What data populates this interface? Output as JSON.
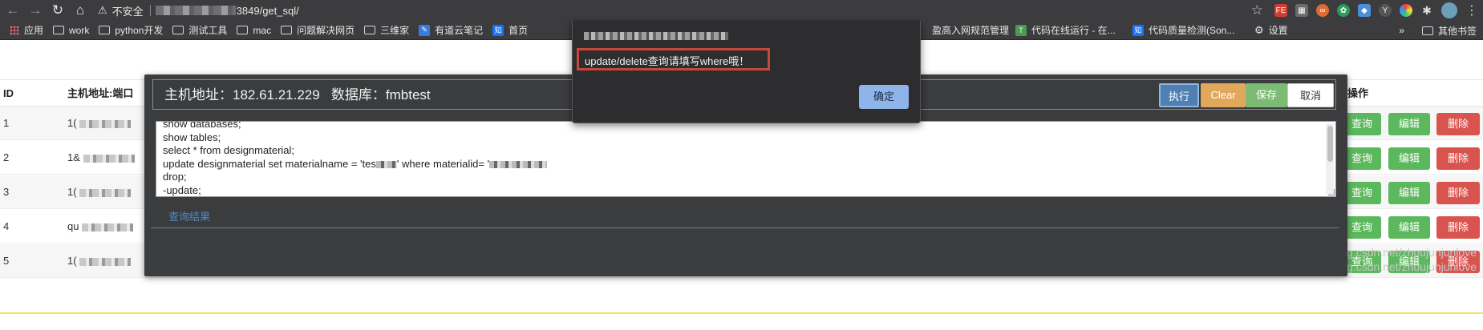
{
  "browser": {
    "insecure_label": "不安全",
    "url_suffix": "3849/get_sql/",
    "bookmarks": [
      {
        "label": "应用",
        "icon": "apps-icon"
      },
      {
        "label": "work",
        "icon": "folder-icon"
      },
      {
        "label": "python开发",
        "icon": "folder-icon"
      },
      {
        "label": "测试工具",
        "icon": "folder-icon"
      },
      {
        "label": "mac",
        "icon": "folder-icon"
      },
      {
        "label": "问题解决网页",
        "icon": "folder-icon"
      },
      {
        "label": "三维家",
        "icon": "folder-icon"
      },
      {
        "label": "有道云笔记",
        "icon": "youdao-icon"
      },
      {
        "label": "首页",
        "icon": "zhihu-icon"
      }
    ],
    "bookmarks_right": [
      {
        "label": "盈高入网规范管理"
      },
      {
        "label": "代码在线运行 - 在..."
      },
      {
        "label": "代码质量检测(Son..."
      },
      {
        "label": "设置"
      }
    ],
    "other_bookmarks": "其他书签"
  },
  "table": {
    "headers": {
      "id": "ID",
      "host": "主机地址:端口",
      "actions": "操作"
    },
    "rows": [
      {
        "id": "1",
        "host_prefix": "1("
      },
      {
        "id": "2",
        "host_prefix": "1&"
      },
      {
        "id": "3",
        "host_prefix": "1("
      },
      {
        "id": "4",
        "host_prefix": "qu"
      },
      {
        "id": "5",
        "host_prefix": "1("
      }
    ],
    "query_label": "查询",
    "edit_label": "编辑",
    "delete_label": "删除"
  },
  "panel": {
    "host_label": "主机地址：182.61.21.229",
    "db_label": "数据库：fmbtest",
    "exec_label": "执行",
    "clear_label": "Clear",
    "save_label": "保存",
    "cancel_label": "取消",
    "code_lines": [
      "show databases;",
      "show tables;",
      "select * from designmaterial;",
      "update designmaterial set materialname = 'tes",
      "drop;",
      "-update;"
    ],
    "code_line4_mid": "' where materialid= '",
    "result_link": "查询结果"
  },
  "alert": {
    "message": "update/delete查询请填写where哦！",
    "ok_label": "确定"
  },
  "watermark": {
    "line1": "https://blog.csdn.net/zhoujunjunlove",
    "line2": "https://blog.csdn.net/zhoujunjunlove"
  },
  "colors": {
    "exec": "#4f7fb3",
    "clear": "#e1a85c",
    "save": "#7cbb74",
    "query": "#5cb85c",
    "delete": "#d9534f",
    "alert_highlight": "#c7473a"
  }
}
